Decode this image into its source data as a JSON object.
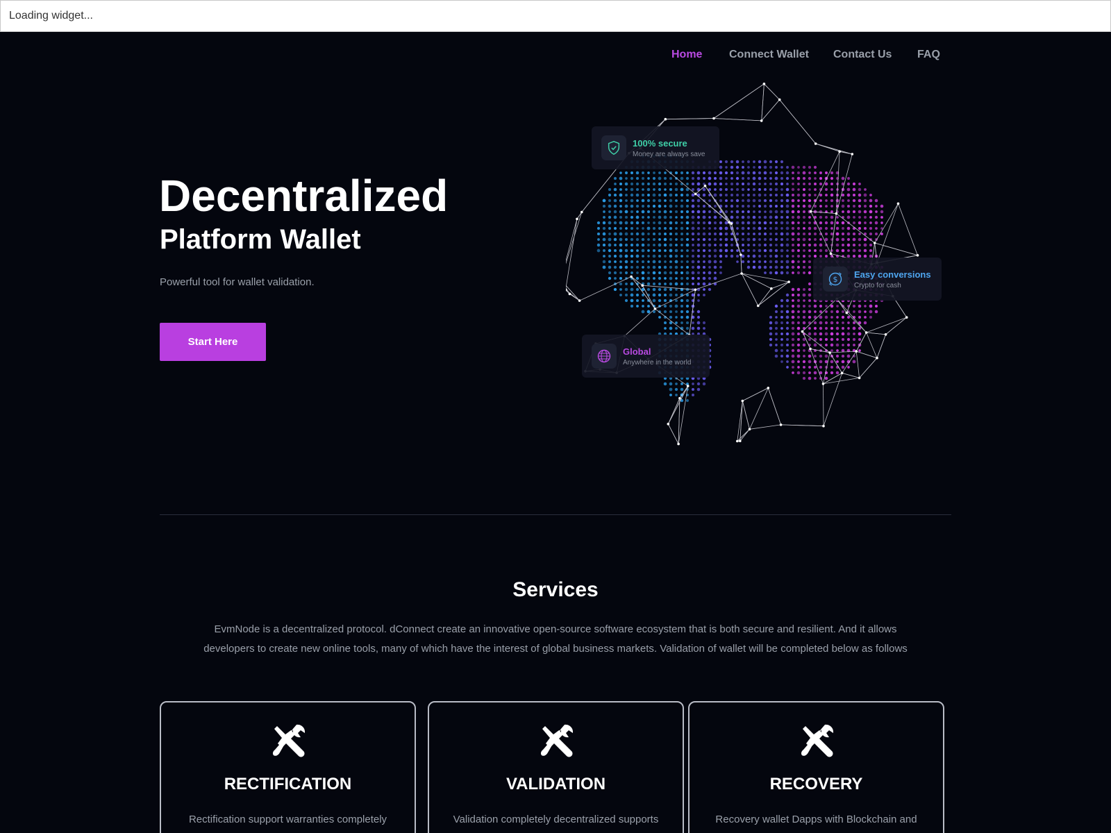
{
  "loading_bar": {
    "text": "Loading widget..."
  },
  "nav": {
    "items": [
      {
        "label": "Home",
        "active": true
      },
      {
        "label": "Connect Wallet",
        "active": false
      },
      {
        "label": "Contact Us",
        "active": false
      },
      {
        "label": "FAQ",
        "active": false
      }
    ]
  },
  "hero": {
    "title": "Decentralized",
    "subtitle": "Platform Wallet",
    "tagline": "Powerful tool for wallet validation.",
    "cta_label": "Start Here"
  },
  "feature_cards": [
    {
      "title": "100% secure",
      "subtitle": "Money are always save",
      "icon": "shield-icon",
      "color": "#3fd0a8"
    },
    {
      "title": "Easy conversions",
      "subtitle": "Crypto for cash",
      "icon": "dollar-exchange-icon",
      "color": "#4fa6f0"
    },
    {
      "title": "Global",
      "subtitle": "Anywhere in the world",
      "icon": "globe-icon",
      "color": "#b94ae2"
    }
  ],
  "services": {
    "title": "Services",
    "description": "EvmNode is a decentralized protocol. dConnect create an innovative open-source software ecosystem that is both secure and resilient. And it allows developers to create new online tools, many of which have the interest of global business markets. Validation of wallet will be completed below as follows",
    "cards": [
      {
        "title": "RECTIFICATION",
        "description": "Rectification support warranties completely",
        "icon": "tools-icon"
      },
      {
        "title": "VALIDATION",
        "description": "Validation completely decentralized supports",
        "icon": "tools-icon"
      },
      {
        "title": "RECOVERY",
        "description": "Recovery wallet Dapps with Blockchain and",
        "icon": "tools-icon"
      }
    ]
  },
  "colors": {
    "accent": "#b93fe0",
    "background": "#04060e",
    "muted_text": "#9aa0aa"
  }
}
